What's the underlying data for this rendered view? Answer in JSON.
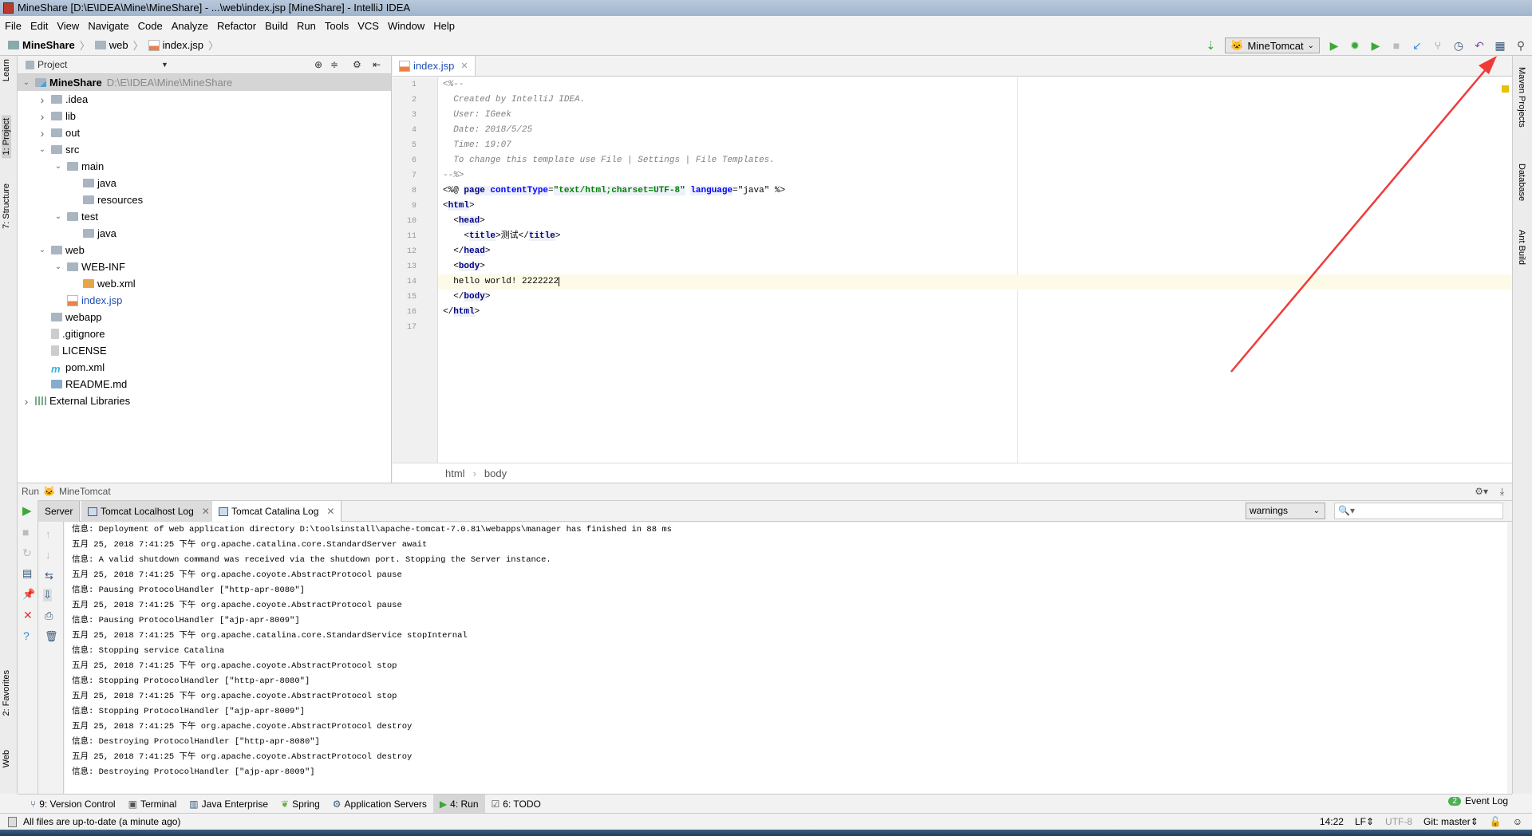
{
  "window": {
    "title": "MineShare [D:\\E\\IDEA\\Mine\\MineShare] - ...\\web\\index.jsp [MineShare] - IntelliJ IDEA"
  },
  "menu": [
    "File",
    "Edit",
    "View",
    "Navigate",
    "Code",
    "Analyze",
    "Refactor",
    "Build",
    "Run",
    "Tools",
    "VCS",
    "Window",
    "Help"
  ],
  "nav": {
    "crumbs": [
      "MineShare",
      "web",
      "index.jsp"
    ]
  },
  "toolbar": {
    "run_config": "MineTomcat",
    "icons": [
      "sort-icon",
      "run-icon",
      "debug-icon",
      "coverage-icon",
      "stop-icon",
      "vcs-update-icon",
      "vcs-commit-icon",
      "vcs-history-icon",
      "revert-icon",
      "project-structure-icon",
      "search-icon"
    ]
  },
  "left_stripe": [
    "Learn",
    "1: Project",
    "7: Structure",
    "2: Favorites",
    "Web"
  ],
  "right_stripe": [
    "Maven Projects",
    "Database",
    "Ant Build"
  ],
  "project": {
    "header": "Project",
    "tree": [
      {
        "label": "MineShare",
        "path": "D:\\E\\IDEA\\Mine\\MineShare",
        "depth": 0,
        "state": "open",
        "icon": "module",
        "bold": true
      },
      {
        "label": ".idea",
        "depth": 1,
        "state": "closed",
        "icon": "folder"
      },
      {
        "label": "lib",
        "depth": 1,
        "state": "closed",
        "icon": "folder"
      },
      {
        "label": "out",
        "depth": 1,
        "state": "closed",
        "icon": "folder"
      },
      {
        "label": "src",
        "depth": 1,
        "state": "open",
        "icon": "folder"
      },
      {
        "label": "main",
        "depth": 2,
        "state": "open",
        "icon": "folder"
      },
      {
        "label": "java",
        "depth": 3,
        "state": "none",
        "icon": "folder"
      },
      {
        "label": "resources",
        "depth": 3,
        "state": "none",
        "icon": "folder"
      },
      {
        "label": "test",
        "depth": 2,
        "state": "open",
        "icon": "folder"
      },
      {
        "label": "java",
        "depth": 3,
        "state": "none",
        "icon": "folder"
      },
      {
        "label": "web",
        "depth": 1,
        "state": "open",
        "icon": "folder"
      },
      {
        "label": "WEB-INF",
        "depth": 2,
        "state": "open",
        "icon": "folder"
      },
      {
        "label": "web.xml",
        "depth": 3,
        "state": "none",
        "icon": "xml"
      },
      {
        "label": "index.jsp",
        "depth": 2,
        "state": "none",
        "icon": "jsp",
        "color": "#1e4fb0"
      },
      {
        "label": "webapp",
        "depth": 1,
        "state": "none",
        "icon": "folder"
      },
      {
        "label": ".gitignore",
        "depth": 1,
        "state": "none",
        "icon": "file"
      },
      {
        "label": "LICENSE",
        "depth": 1,
        "state": "none",
        "icon": "file"
      },
      {
        "label": "pom.xml",
        "depth": 1,
        "state": "none",
        "icon": "maven"
      },
      {
        "label": "README.md",
        "depth": 1,
        "state": "none",
        "icon": "md"
      },
      {
        "label": "External Libraries",
        "depth": 0,
        "state": "closed",
        "icon": "libs"
      }
    ]
  },
  "editor": {
    "tab": "index.jsp",
    "current_line": 14,
    "lines": [
      [
        [
          "cmt",
          "<%--"
        ]
      ],
      [
        [
          "cmt",
          "  Created by IntelliJ IDEA."
        ]
      ],
      [
        [
          "cmt",
          "  User: IGeek"
        ]
      ],
      [
        [
          "cmt",
          "  Date: 2018/5/25"
        ]
      ],
      [
        [
          "cmt",
          "  Time: 19:07"
        ]
      ],
      [
        [
          "cmt",
          "  To change this template use File | Settings | File Templates."
        ]
      ],
      [
        [
          "cmt",
          "--%>"
        ]
      ],
      [
        [
          "plain",
          "<%@ "
        ],
        [
          "tag",
          "page "
        ],
        [
          "attr",
          "contentType"
        ],
        [
          "plain",
          "="
        ],
        [
          "str",
          "\"text/html;charset=UTF-8\""
        ],
        [
          "plain",
          " "
        ],
        [
          "attr",
          "language"
        ],
        [
          "plain",
          "=\"java\" %>"
        ]
      ],
      [
        [
          "plain",
          "<"
        ],
        [
          "tag",
          "html"
        ],
        [
          "plain",
          ">"
        ]
      ],
      [
        [
          "plain",
          "  <"
        ],
        [
          "tag",
          "head"
        ],
        [
          "plain",
          ">"
        ]
      ],
      [
        [
          "plain",
          "    <"
        ],
        [
          "tag",
          "title"
        ],
        [
          "plain",
          ">测试</"
        ],
        [
          "tag",
          "title"
        ],
        [
          "plain",
          ">"
        ]
      ],
      [
        [
          "plain",
          "  </"
        ],
        [
          "tag",
          "head"
        ],
        [
          "plain",
          ">"
        ]
      ],
      [
        [
          "plain",
          "  <"
        ],
        [
          "tag",
          "body"
        ],
        [
          "plain",
          ">"
        ]
      ],
      [
        [
          "plain",
          "  hello world! 2222222"
        ]
      ],
      [
        [
          "plain",
          "  </"
        ],
        [
          "tag",
          "body"
        ],
        [
          "plain",
          ">"
        ]
      ],
      [
        [
          "plain",
          "</"
        ],
        [
          "tag",
          "html"
        ],
        [
          "plain",
          ">"
        ]
      ],
      [
        [
          "plain",
          ""
        ]
      ]
    ],
    "breadcrumbs": [
      "html",
      "body"
    ]
  },
  "run": {
    "label": "Run",
    "config": "MineTomcat",
    "tabs": [
      "Server",
      "Tomcat Localhost Log",
      "Tomcat Catalina Log"
    ],
    "active_tab": 2,
    "filter": "warnings",
    "search_placeholder": "",
    "log": [
      "信息: Deployment of web application directory D:\\toolsinstall\\apache-tomcat-7.0.81\\webapps\\manager has finished in 88 ms",
      "五月 25, 2018 7:41:25 下午 org.apache.catalina.core.StandardServer await",
      "信息: A valid shutdown command was received via the shutdown port. Stopping the Server instance.",
      "五月 25, 2018 7:41:25 下午 org.apache.coyote.AbstractProtocol pause",
      "信息: Pausing ProtocolHandler [\"http-apr-8080\"]",
      "五月 25, 2018 7:41:25 下午 org.apache.coyote.AbstractProtocol pause",
      "信息: Pausing ProtocolHandler [\"ajp-apr-8009\"]",
      "五月 25, 2018 7:41:25 下午 org.apache.catalina.core.StandardService stopInternal",
      "信息: Stopping service Catalina",
      "五月 25, 2018 7:41:25 下午 org.apache.coyote.AbstractProtocol stop",
      "信息: Stopping ProtocolHandler [\"http-apr-8080\"]",
      "五月 25, 2018 7:41:25 下午 org.apache.coyote.AbstractProtocol stop",
      "信息: Stopping ProtocolHandler [\"ajp-apr-8009\"]",
      "五月 25, 2018 7:41:25 下午 org.apache.coyote.AbstractProtocol destroy",
      "信息: Destroying ProtocolHandler [\"http-apr-8080\"]",
      "五月 25, 2018 7:41:25 下午 org.apache.coyote.AbstractProtocol destroy",
      "信息: Destroying ProtocolHandler [\"ajp-apr-8009\"]"
    ]
  },
  "tool_windows": [
    "9: Version Control",
    "Terminal",
    "Java Enterprise",
    "Spring",
    "Application Servers",
    "4: Run",
    "6: TODO"
  ],
  "event_log": {
    "count": "2",
    "label": "Event Log"
  },
  "status": {
    "message": "All files are up-to-date (a minute ago)",
    "position": "14:22",
    "line_sep": "LF",
    "encoding": "UTF-8",
    "vcs": "Git: master"
  },
  "colors": {
    "annotation_arrow": "#f03a3a",
    "run_green": "#3aa935",
    "link_blue": "#1e4fb0"
  }
}
